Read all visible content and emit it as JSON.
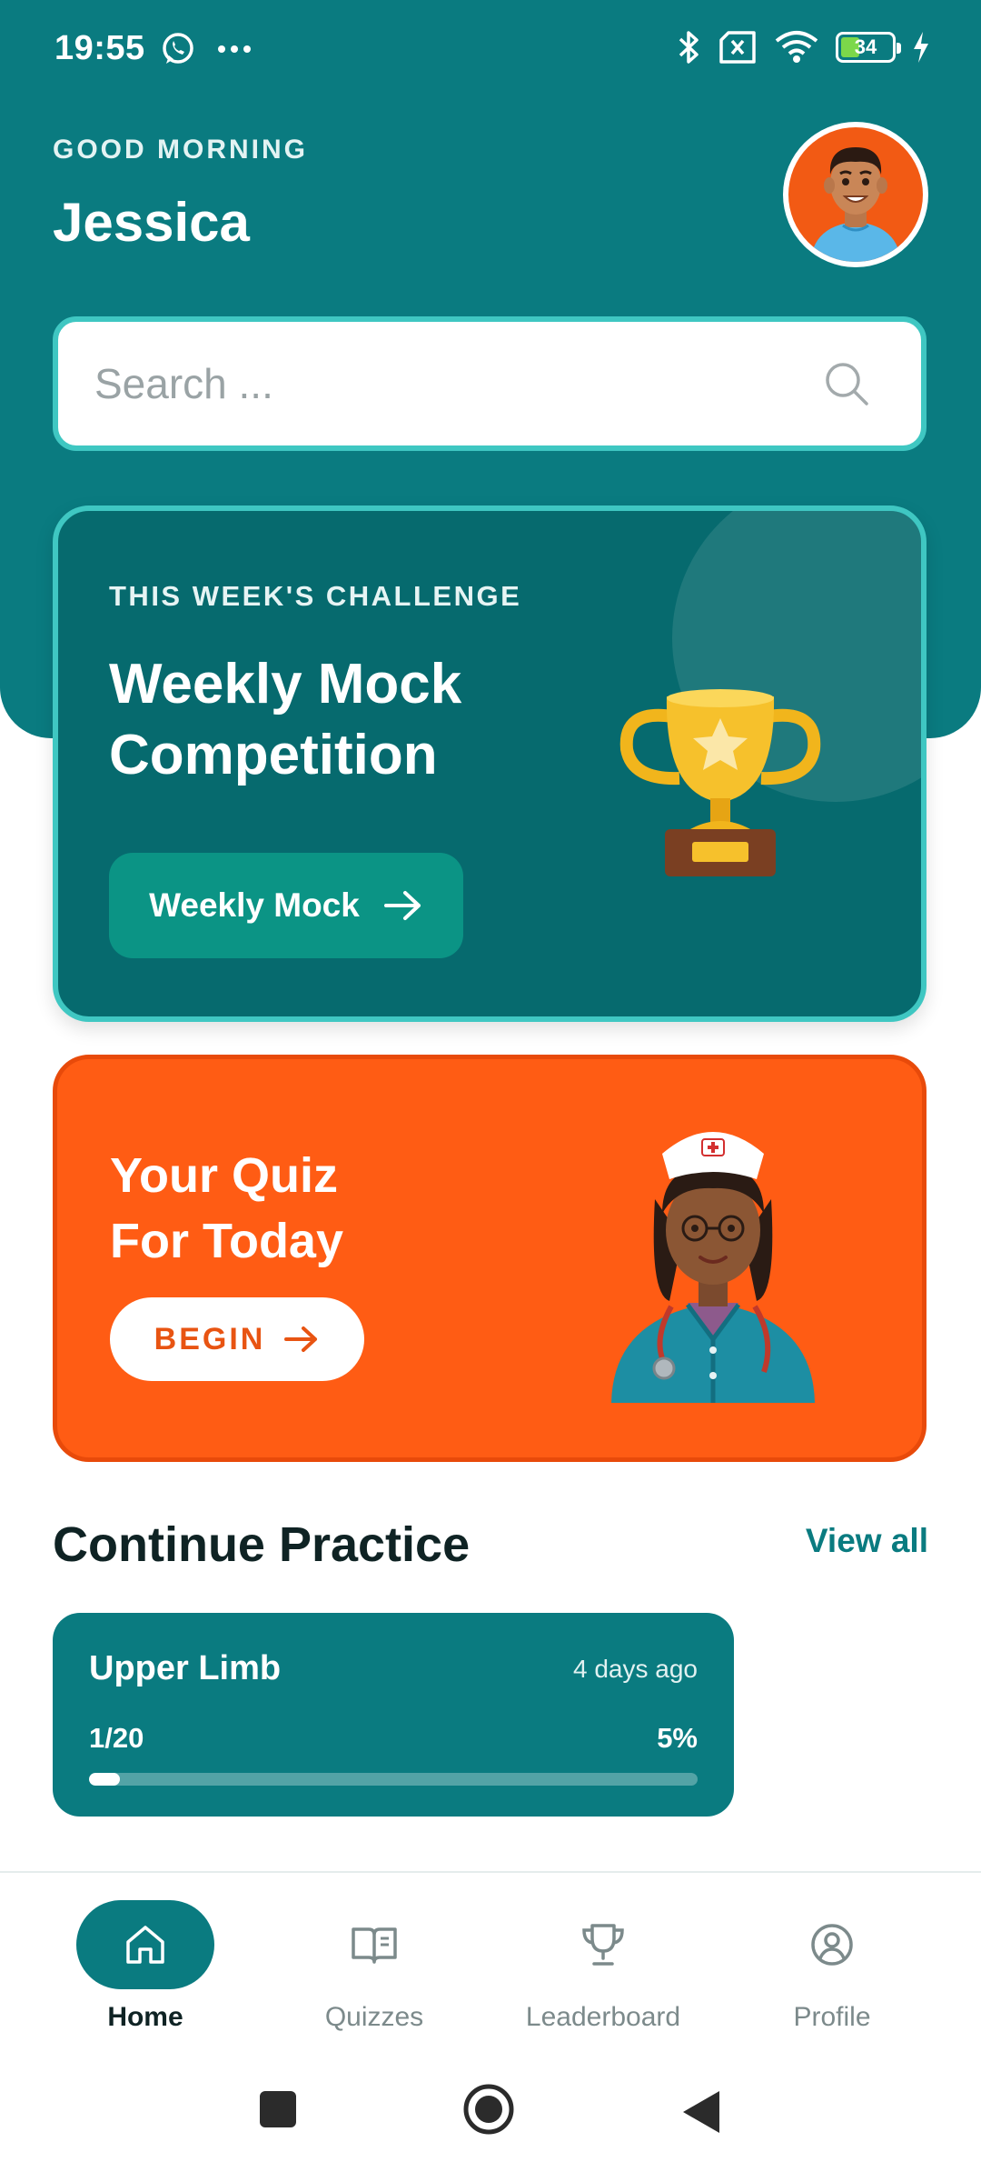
{
  "status_bar": {
    "time": "19:55",
    "battery_level": "34",
    "icons": [
      "whatsapp-icon",
      "more-dots-icon",
      "bluetooth-icon",
      "no-sim-icon",
      "wifi-icon",
      "battery-icon",
      "charging-icon"
    ]
  },
  "header": {
    "greeting": "GOOD MORNING",
    "user_name": "Jessica",
    "avatar_icon": "user-avatar"
  },
  "search": {
    "placeholder": "Search ...",
    "value": ""
  },
  "challenge": {
    "label": "THIS WEEK'S CHALLENGE",
    "title": "Weekly Mock Competition",
    "button_label": "Weekly Mock",
    "image": "trophy-icon"
  },
  "quiz": {
    "title_line1": "Your Quiz",
    "title_line2": "For Today",
    "button_label": "BEGIN",
    "image": "nurse-illustration"
  },
  "continue_practice": {
    "title": "Continue Practice",
    "view_all": "View all",
    "items": [
      {
        "name": "Upper Limb",
        "time_ago": "4 days ago",
        "count": "1/20",
        "percent_label": "5%",
        "progress": 0.05
      }
    ]
  },
  "bottom_nav": {
    "items": [
      {
        "label": "Home",
        "icon": "home-icon",
        "active": true
      },
      {
        "label": "Quizzes",
        "icon": "book-icon",
        "active": false
      },
      {
        "label": "Leaderboard",
        "icon": "trophy-outline-icon",
        "active": false
      },
      {
        "label": "Profile",
        "icon": "profile-icon",
        "active": false
      }
    ]
  },
  "system_nav": [
    "recents-button",
    "home-button",
    "back-button"
  ],
  "colors": {
    "primary": "#0a7b80",
    "accent_border": "#3fc7c2",
    "orange": "#ff5c14"
  }
}
